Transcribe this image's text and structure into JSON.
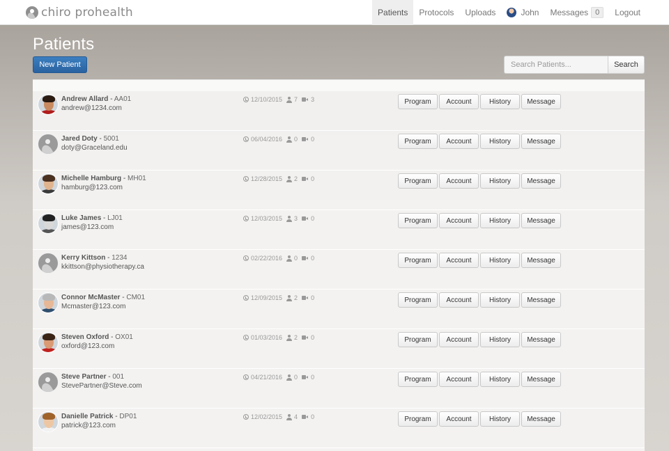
{
  "brand": {
    "name": "chiro prohealth"
  },
  "nav": {
    "items": [
      {
        "label": "Patients",
        "active": true
      },
      {
        "label": "Protocols",
        "active": false
      },
      {
        "label": "Uploads",
        "active": false
      }
    ],
    "user": "John",
    "messages_label": "Messages",
    "messages_count": "0",
    "logout": "Logout"
  },
  "page": {
    "title": "Patients",
    "new_button": "New Patient",
    "search_placeholder": "Search Patients...",
    "search_button": "Search"
  },
  "row_actions": [
    "Program",
    "Account",
    "History",
    "Message"
  ],
  "patients": [
    {
      "name": "Andrew Allard",
      "code": "AA01",
      "email": "andrew@1234.com",
      "date": "12/10/2015",
      "people": "7",
      "videos": "3",
      "avatar": "photo",
      "skin": "#c98a60",
      "hair": "#2b1a10",
      "body": "#b11c1c"
    },
    {
      "name": "Jared Doty",
      "code": "5001",
      "email": "doty@Graceland.edu",
      "date": "06/04/2016",
      "people": "0",
      "videos": "0",
      "avatar": "default"
    },
    {
      "name": "Michelle Hamburg",
      "code": "MH01",
      "email": "hamburg@123.com",
      "date": "12/28/2015",
      "people": "2",
      "videos": "0",
      "avatar": "photo",
      "skin": "#e0b48e",
      "hair": "#4a3120",
      "body": "#3a3a3a"
    },
    {
      "name": "Luke James",
      "code": "LJ01",
      "email": "james@123.com",
      "date": "12/03/2015",
      "people": "3",
      "videos": "0",
      "avatar": "photo",
      "skin": "#d9d9d9",
      "hair": "#222222",
      "body": "#555555"
    },
    {
      "name": "Kerry Kittson",
      "code": "1234",
      "email": "kkittson@physiotherapy.ca",
      "date": "02/22/2016",
      "people": "0",
      "videos": "0",
      "avatar": "default"
    },
    {
      "name": "Connor McMaster",
      "code": "CM01",
      "email": "Mcmaster@123.com",
      "date": "12/09/2015",
      "people": "2",
      "videos": "0",
      "avatar": "photo",
      "skin": "#e6b897",
      "hair": "#b8b8b8",
      "body": "#2f4f6f"
    },
    {
      "name": "Steven Oxford",
      "code": "OX01",
      "email": "oxford@123.com",
      "date": "01/03/2016",
      "people": "2",
      "videos": "0",
      "avatar": "photo",
      "skin": "#d99a74",
      "hair": "#3a2415",
      "body": "#c0221f"
    },
    {
      "name": "Steve Partner",
      "code": "001",
      "email": "StevePartner@Steve.com",
      "date": "04/21/2016",
      "people": "0",
      "videos": "0",
      "avatar": "default"
    },
    {
      "name": "Danielle Patrick",
      "code": "DP01",
      "email": "patrick@123.com",
      "date": "12/02/2015",
      "people": "4",
      "videos": "0",
      "avatar": "photo",
      "skin": "#edc7a4",
      "hair": "#a0632a",
      "body": "#f2f2f2"
    }
  ]
}
